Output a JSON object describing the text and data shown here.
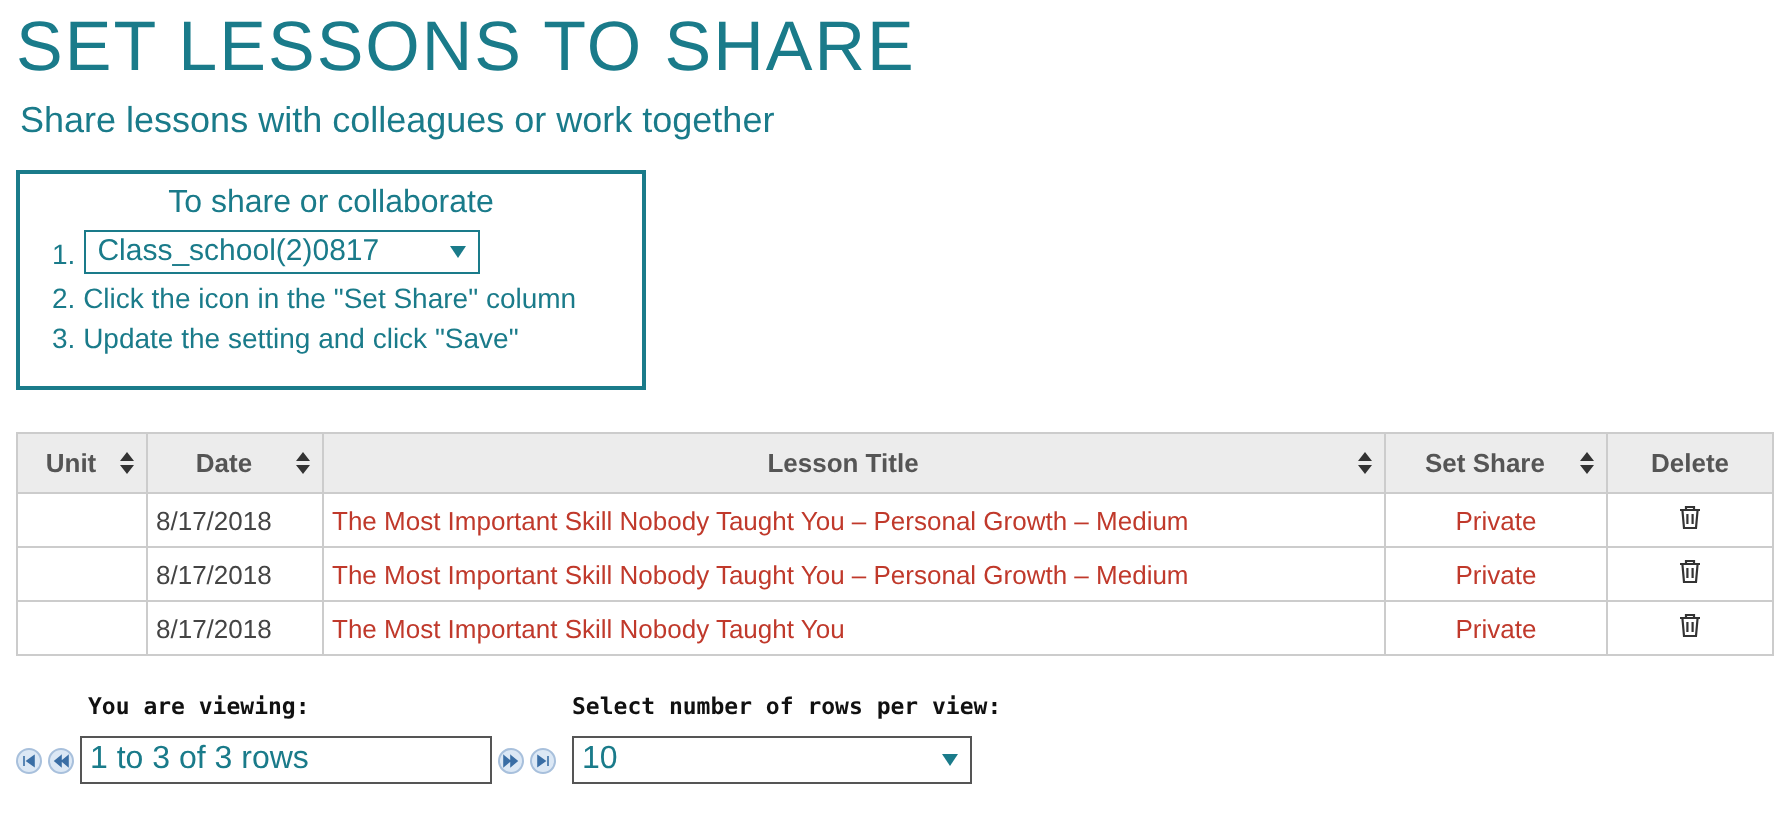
{
  "title": "SET LESSONS TO SHARE",
  "subtitle": "Share lessons with colleagues or work together",
  "instructions": {
    "heading": "To share or collaborate",
    "steps": [
      {
        "kind": "select",
        "number": "1.",
        "value": "Class_school(2)0817"
      },
      {
        "kind": "text",
        "text": "2. Click the icon in the \"Set Share\" column"
      },
      {
        "kind": "text",
        "text": "3. Update the setting and click \"Save\""
      }
    ]
  },
  "table": {
    "columns": [
      {
        "label": "Unit",
        "sortable": true
      },
      {
        "label": "Date",
        "sortable": true
      },
      {
        "label": "Lesson Title",
        "sortable": true
      },
      {
        "label": "Set Share",
        "sortable": true
      },
      {
        "label": "Delete",
        "sortable": false
      }
    ],
    "rows": [
      {
        "unit_cell": "",
        "date": "8/17/2018",
        "lesson_title": "The Most Important Skill Nobody Taught You – Personal Growth – Medium",
        "set_share": "Private"
      },
      {
        "date": "8/17/2018",
        "lesson_title": "The Most Important Skill Nobody Taught You – Personal Growth – Medium",
        "set_share": "Private"
      },
      {
        "date": "8/17/2018",
        "lesson_title": "The Most Important Skill Nobody Taught You",
        "set_share": "Private"
      }
    ]
  },
  "pager": {
    "viewing_label": "You are viewing:",
    "viewing_value": "1 to 3 of 3 rows",
    "rows_label": "Select number of rows per view:",
    "rows_value": "10"
  }
}
